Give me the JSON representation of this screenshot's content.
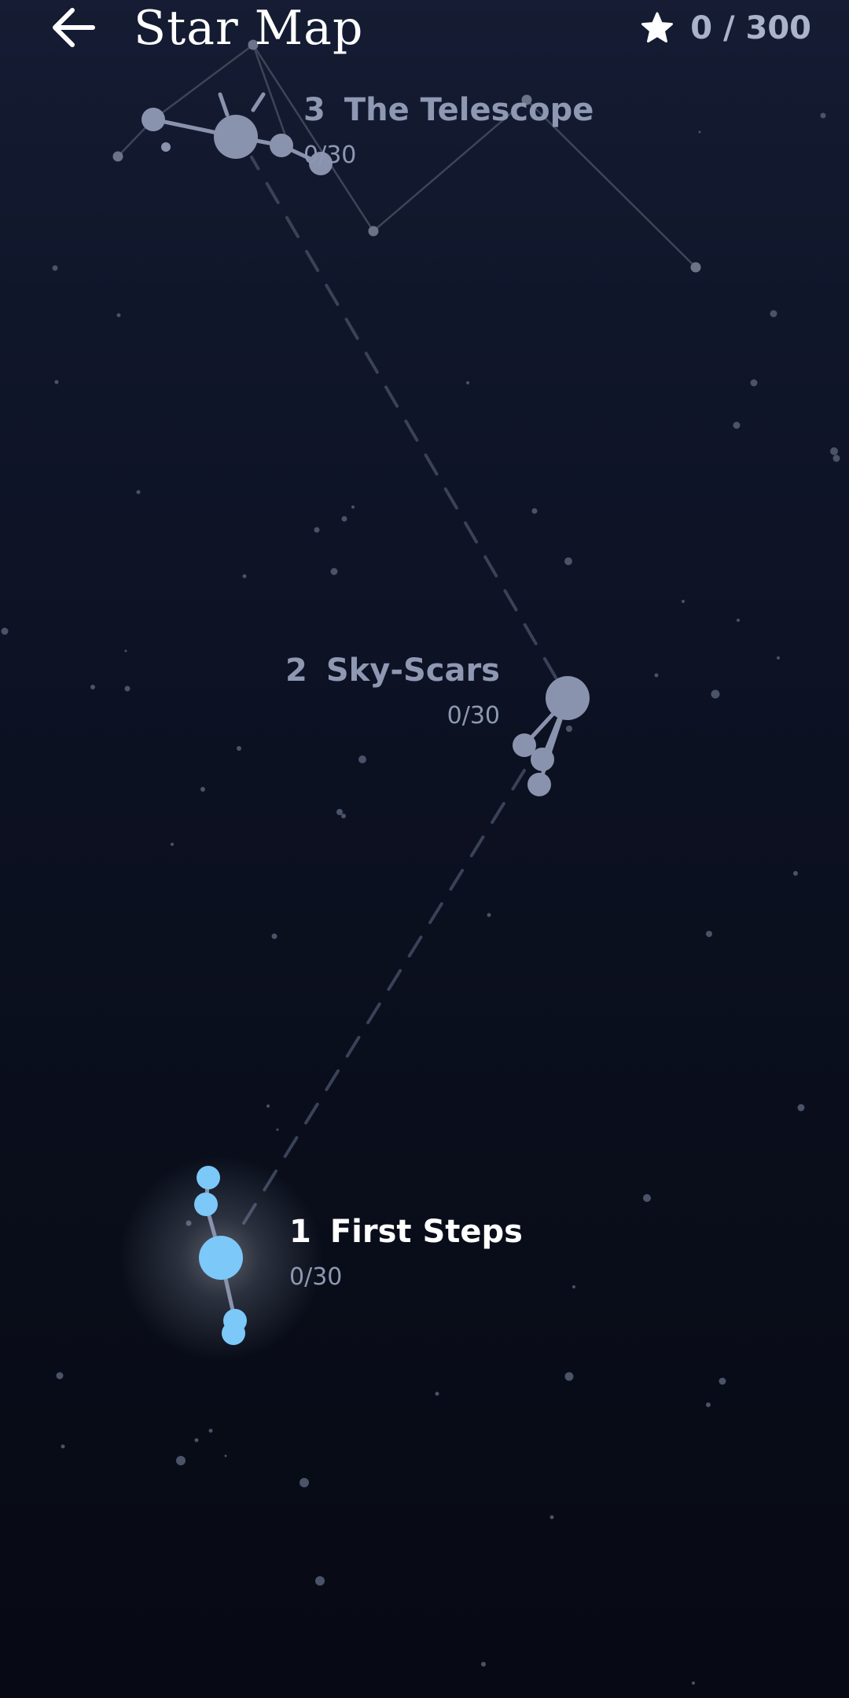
{
  "header": {
    "back_icon": "arrow-left-icon",
    "title": "Star Map",
    "star_icon": "star-icon",
    "stars_collected": 0,
    "stars_total": 300,
    "stars_text": "0 / 300"
  },
  "levels": [
    {
      "number": "1",
      "name": "First Steps",
      "progress": "0/30",
      "state": "active",
      "color": "#7cc8f8"
    },
    {
      "number": "2",
      "name": "Sky-Scars",
      "progress": "0/30",
      "state": "locked",
      "color": "#8a93ad"
    },
    {
      "number": "3",
      "name": "The Telescope",
      "progress": "0/30",
      "state": "locked",
      "color": "#8a93ad"
    }
  ],
  "colors": {
    "active_star": "#7cc8f8",
    "locked_star": "#8a93ad",
    "path_dash": "#3a4258",
    "background_top": "#151c33",
    "background_bottom": "#070a14"
  }
}
